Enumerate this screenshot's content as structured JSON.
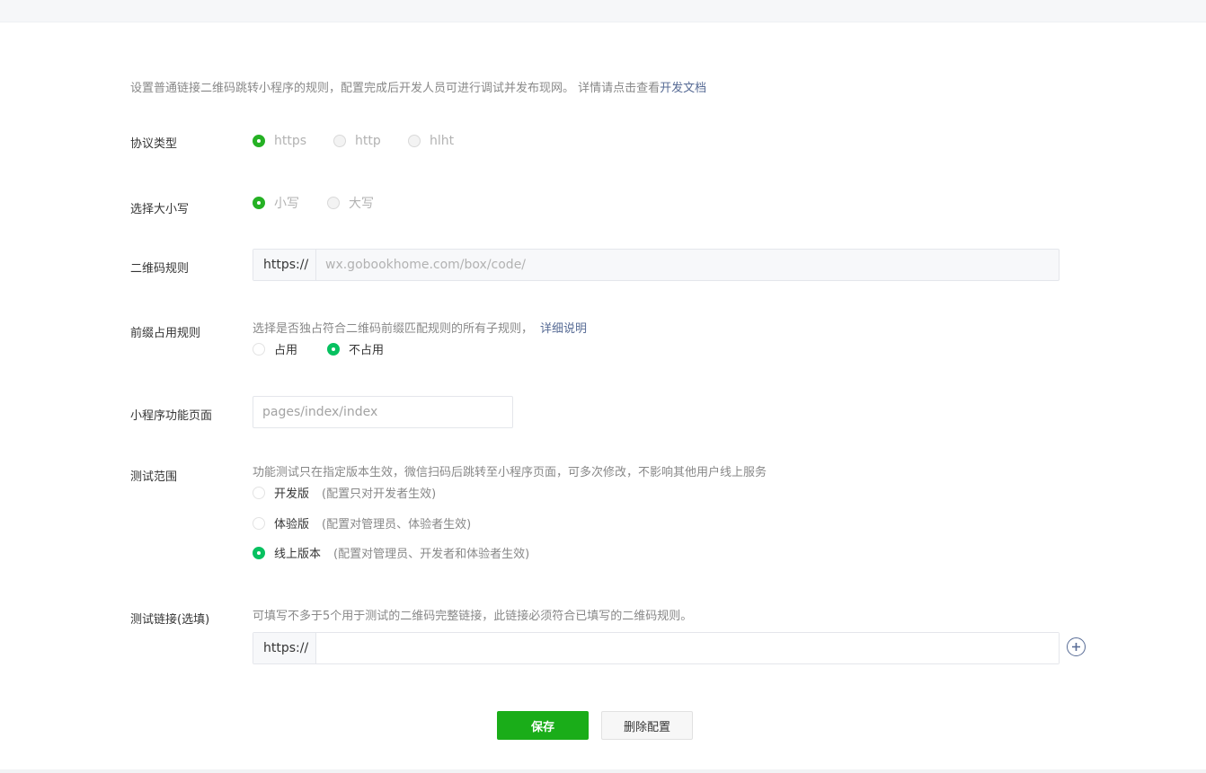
{
  "top_fragment": "· ·",
  "intro": {
    "text": "设置普通链接二维码跳转小程序的规则，配置完成后开发人员可进行调试并发布现网。 详情请点击查看",
    "link": "开发文档"
  },
  "protocol": {
    "label": "协议类型",
    "options": [
      "https",
      "http",
      "hlht"
    ],
    "selected": "https"
  },
  "case": {
    "label": "选择大小写",
    "options": [
      "小写",
      "大写"
    ],
    "selected": "小写"
  },
  "qr_rule": {
    "label": "二维码规则",
    "prefix": "https://",
    "value": "wx.gobookhome.com/box/code/"
  },
  "prefix_rule": {
    "label": "前缀占用规则",
    "description": "选择是否独占符合二维码前缀匹配规则的所有子规则，",
    "link": "详细说明",
    "options": [
      "占用",
      "不占用"
    ],
    "selected": "不占用"
  },
  "mini_page": {
    "label": "小程序功能页面",
    "value": "pages/index/index"
  },
  "test_scope": {
    "label": "测试范围",
    "description": "功能测试只在指定版本生效，微信扫码后跳转至小程序页面，可多次修改，不影响其他用户线上服务",
    "options": [
      {
        "name": "开发版",
        "hint": "(配置只对开发者生效)"
      },
      {
        "name": "体验版",
        "hint": "(配置对管理员、体验者生效)"
      },
      {
        "name": "线上版本",
        "hint": "(配置对管理员、开发者和体验者生效)"
      }
    ],
    "selected": "线上版本"
  },
  "test_link": {
    "label": "测试链接(选填)",
    "description": "可填写不多于5个用于测试的二维码完整链接，此链接必须符合已填写的二维码规则。",
    "prefix": "https://",
    "value": ""
  },
  "actions": {
    "save": "保存",
    "delete": "删除配置"
  },
  "colors": {
    "primary_green": "#1aad19",
    "radio_green": "#07c160",
    "link_blue": "#576b95"
  }
}
